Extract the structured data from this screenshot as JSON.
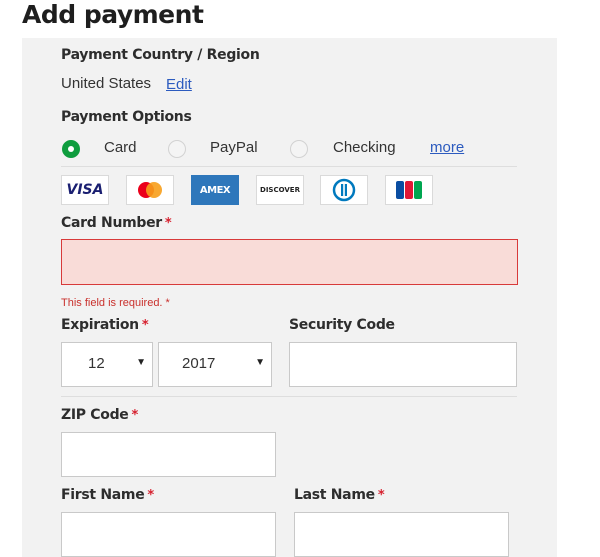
{
  "title": "Add payment",
  "country": {
    "label": "Payment Country / Region",
    "value": "United States",
    "edit_link": "Edit"
  },
  "payment_options": {
    "label": "Payment Options",
    "options": [
      {
        "label": "Card",
        "selected": true
      },
      {
        "label": "PayPal",
        "selected": false
      },
      {
        "label": "Checking",
        "selected": false
      }
    ],
    "more_link": "more"
  },
  "cards": [
    {
      "name": "visa-logo",
      "text": "VISA"
    },
    {
      "name": "mastercard-logo",
      "text": ""
    },
    {
      "name": "amex-logo",
      "text": "AMEX"
    },
    {
      "name": "discover-logo",
      "text": "DISCOVER"
    },
    {
      "name": "diners-logo",
      "text": ""
    },
    {
      "name": "jcb-logo",
      "text": ""
    }
  ],
  "card_number": {
    "label": "Card Number",
    "required_mark": "*",
    "value": "",
    "error": "This field is required. *"
  },
  "expiration": {
    "label": "Expiration",
    "required_mark": "*",
    "month": "12",
    "year": "2017"
  },
  "security_code": {
    "label": "Security Code",
    "value": ""
  },
  "zip_code": {
    "label": "ZIP Code",
    "required_mark": "*",
    "value": ""
  },
  "first_name": {
    "label": "First Name",
    "required_mark": "*",
    "value": ""
  },
  "last_name": {
    "label": "Last Name",
    "required_mark": "*",
    "value": ""
  },
  "colors": {
    "selected_radio": "#0f9d3e",
    "link": "#2c5bbf",
    "error": "#d6212f",
    "error_field_bg": "#f9dcd8",
    "panel_bg": "#f2f2f2"
  }
}
